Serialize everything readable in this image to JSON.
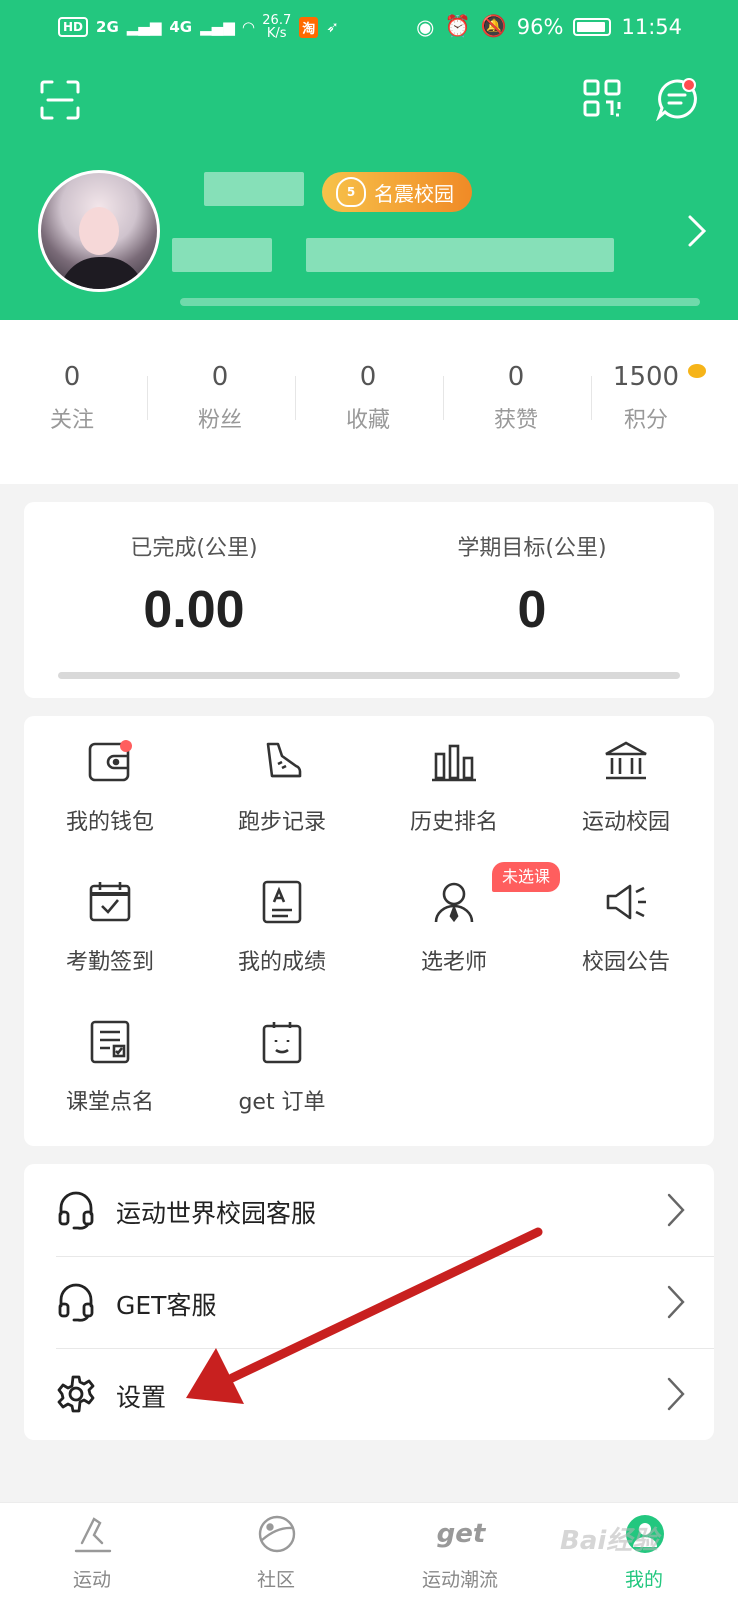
{
  "status_bar": {
    "hd": "HD",
    "net1": "2G",
    "net2": "4G",
    "speed_value": "26.7",
    "speed_unit": "K/s",
    "taobao": "淘",
    "battery_pct": "96%",
    "time": "11:54"
  },
  "header": {
    "badge_label": "名震校园",
    "badge_level": "5",
    "icons": [
      "scan-icon",
      "qr-code-icon",
      "message-icon"
    ]
  },
  "stats": [
    {
      "value": "0",
      "label": "关注"
    },
    {
      "value": "0",
      "label": "粉丝"
    },
    {
      "value": "0",
      "label": "收藏"
    },
    {
      "value": "0",
      "label": "获赞"
    },
    {
      "value": "1500",
      "label": "积分"
    }
  ],
  "distance": {
    "completed_label": "已完成(公里)",
    "completed_value": "0.00",
    "target_label": "学期目标(公里)",
    "target_value": "0",
    "progress": 0
  },
  "grid": [
    {
      "label": "我的钱包",
      "icon": "wallet-icon"
    },
    {
      "label": "跑步记录",
      "icon": "shoe-icon"
    },
    {
      "label": "历史排名",
      "icon": "ranking-bars-icon"
    },
    {
      "label": "运动校园",
      "icon": "campus-building-icon"
    },
    {
      "label": "考勤签到",
      "icon": "calendar-check-icon"
    },
    {
      "label": "我的成绩",
      "icon": "grade-sheet-icon"
    },
    {
      "label": "选老师",
      "icon": "teacher-icon"
    },
    {
      "label": "校园公告",
      "icon": "speaker-icon"
    },
    {
      "label": "课堂点名",
      "icon": "roll-call-icon"
    },
    {
      "label": "get 订单",
      "icon": "order-icon"
    }
  ],
  "teacher_tag": "未选课",
  "menu": [
    {
      "label": "运动世界校园客服",
      "icon": "headset-icon"
    },
    {
      "label": "GET客服",
      "icon": "headset-icon"
    },
    {
      "label": "设置",
      "icon": "gear-icon"
    }
  ],
  "tabbar": [
    {
      "label": "运动",
      "icon": "run-icon"
    },
    {
      "label": "社区",
      "icon": "planet-icon"
    },
    {
      "label": "运动潮流",
      "icon": "get-logo-icon",
      "logo_text": "get"
    },
    {
      "label": "我的",
      "icon": "profile-icon",
      "active": true
    }
  ],
  "watermark": "Bai经验",
  "colors": {
    "brand": "#23c77f",
    "badge": "#f08a26",
    "alert": "#ff5e5e",
    "annotation_arrow": "#c8201f"
  }
}
